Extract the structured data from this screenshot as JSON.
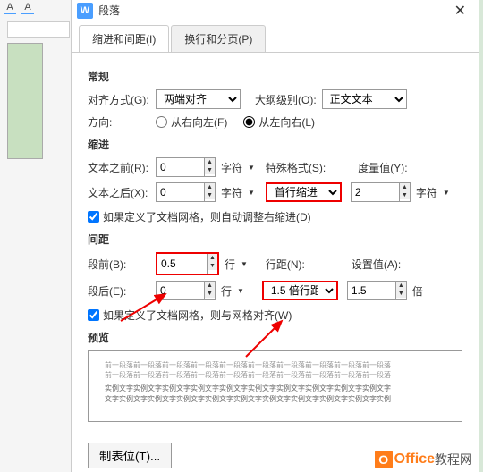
{
  "window": {
    "title": "段落",
    "close": "✕"
  },
  "tabs": {
    "t1": "缩进和间距(I)",
    "t2": "换行和分页(P)"
  },
  "sections": {
    "general": "常规",
    "indent": "缩进",
    "spacing": "间距",
    "preview": "预览"
  },
  "align": {
    "label": "对齐方式(G):",
    "value": "两端对齐"
  },
  "outline": {
    "label": "大纲级别(O):",
    "value": "正文文本"
  },
  "direction": {
    "label": "方向:",
    "rtl": "从右向左(F)",
    "ltr": "从左向右(L)"
  },
  "indent": {
    "before": {
      "label": "文本之前(R):",
      "value": "0",
      "unit": "字符"
    },
    "after": {
      "label": "文本之后(X):",
      "value": "0",
      "unit": "字符"
    },
    "special": {
      "label": "特殊格式(S):",
      "value": "首行缩进"
    },
    "measure": {
      "label": "度量值(Y):",
      "value": "2",
      "unit": "字符"
    },
    "grid_cb": "如果定义了文档网格，则自动调整右缩进(D)"
  },
  "spacing": {
    "before": {
      "label": "段前(B):",
      "value": "0.5",
      "unit": "行"
    },
    "after": {
      "label": "段后(E):",
      "value": "0",
      "unit": "行"
    },
    "line": {
      "label": "行距(N):",
      "value": "1.5 倍行距"
    },
    "set": {
      "label": "设置值(A):",
      "value": "1.5",
      "unit": "倍"
    },
    "grid_cb": "如果定义了文档网格，则与网格对齐(W)"
  },
  "preview_text": {
    "l1": "前一段落前一段落前一段落前一段落前一段落前一段落前一段落前一段落前一段落前一段落",
    "l2": "前一段落前一段落前一段落前一段落前一段落前一段落前一段落前一段落前一段落前一段落",
    "l3": "实例文字实例文字实例文字实例文字实例文字实例文字实例文字实例文字实例文字实例文字",
    "l4": "文字实例文字实例文字实例文字实例文字实例文字实例文字实例文字实例文字实例文字实例"
  },
  "footer": {
    "tabstops": "制表位(T)..."
  },
  "watermark": {
    "brand": "Office",
    "suffix": "教程网"
  },
  "toolbar": {
    "a1": "A",
    "a2": "A"
  }
}
